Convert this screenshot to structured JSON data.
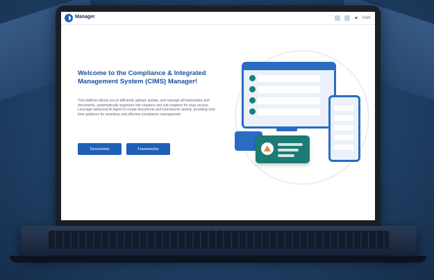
{
  "app": {
    "title": "Manager",
    "user_label": "User"
  },
  "hero": {
    "title": "Welcome to the Compliance & Integrated Management System (CIMS) Manager!",
    "description": "This platform allows you to efficiently upload, update, and manage all frameworks and documents, systematically organizes into chapters and sub-chapters for easy access. Leverage advanced AI Agent to create documents and frameworks quickly, providing real-time guidance for seamless and effective compliance management."
  },
  "buttons": {
    "documents": "Documents",
    "frameworks": "Frameworks"
  },
  "colors": {
    "primary": "#1f5fb8",
    "accent_teal": "#1d7a74",
    "accent_orange": "#e5893b"
  }
}
